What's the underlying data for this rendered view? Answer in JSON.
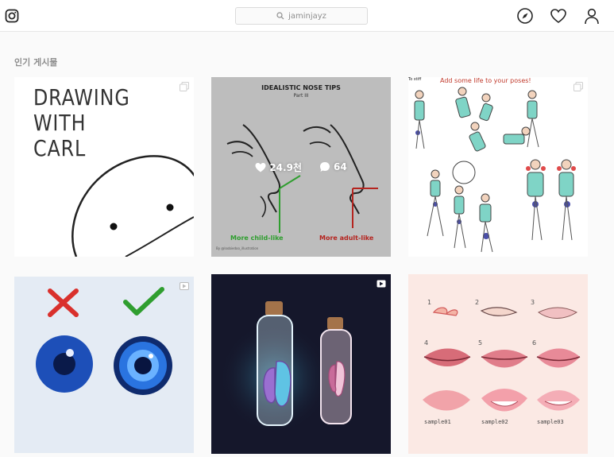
{
  "header": {
    "logo_icon": "instagram-icon",
    "search_placeholder": "jaminjayz",
    "nav_icons": [
      "compass-icon",
      "heart-icon",
      "user-icon"
    ]
  },
  "section": {
    "title": "인기 게시물"
  },
  "posts": [
    {
      "text_lines": [
        "DRAWING",
        "WITH",
        "CARL"
      ],
      "badge": "multiple-icon"
    },
    {
      "title": "IDEALISTIC NOSE TIPS",
      "subtitle": "Part III",
      "left_label": "More child-like",
      "right_label": "More adult-like",
      "credit": "By @loobiedoo_illustration",
      "likes": "24.9천",
      "comments": "64"
    },
    {
      "caption": "Add some life to your poses!",
      "stiff_label": "To stiff",
      "badge": "multiple-icon"
    },
    {
      "badge": "video-icon"
    },
    {
      "badge": "video-icon"
    },
    {
      "numbers": [
        "1",
        "2",
        "3",
        "4",
        "5",
        "6"
      ],
      "labels": [
        "sample01",
        "sample02",
        "sample03"
      ]
    }
  ],
  "colors": {
    "green_check": "#2f9e2f",
    "red_cross": "#d9302c",
    "accent_blue": "#1d4fb8"
  }
}
